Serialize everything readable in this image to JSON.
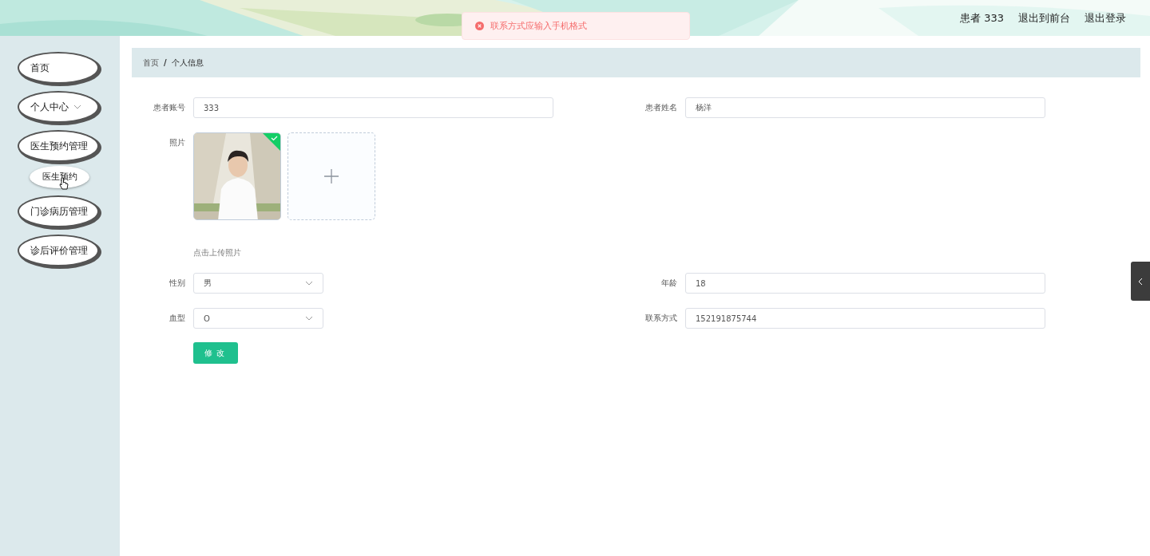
{
  "header": {
    "user": "患者 333",
    "links": [
      "退出到前台",
      "退出登录"
    ]
  },
  "toast": {
    "message": "联系方式应输入手机格式"
  },
  "sidebar": {
    "items": [
      {
        "label": "首页",
        "kind": "link"
      },
      {
        "label": "个人中心",
        "kind": "group"
      },
      {
        "label": "医生预约管理",
        "kind": "link",
        "children": [
          {
            "label": "医生预约",
            "hovered": true
          }
        ]
      },
      {
        "label": "门诊病历管理",
        "kind": "link"
      },
      {
        "label": "诊后评价管理",
        "kind": "link"
      }
    ]
  },
  "breadcrumb": {
    "separator": "/",
    "items": [
      "首页",
      "个人信息"
    ]
  },
  "form": {
    "account": {
      "label": "患者账号",
      "value": "333"
    },
    "name": {
      "label": "患者姓名",
      "value": "杨洋"
    },
    "photo": {
      "label": "照片",
      "uploaded": true,
      "hint": "点击上传照片"
    },
    "gender": {
      "label": "性别",
      "value": "男"
    },
    "age": {
      "label": "年龄",
      "value": "18"
    },
    "blood": {
      "label": "血型",
      "value": "O"
    },
    "phone": {
      "label": "联系方式",
      "value": "152191875744"
    },
    "submit": "修改"
  }
}
